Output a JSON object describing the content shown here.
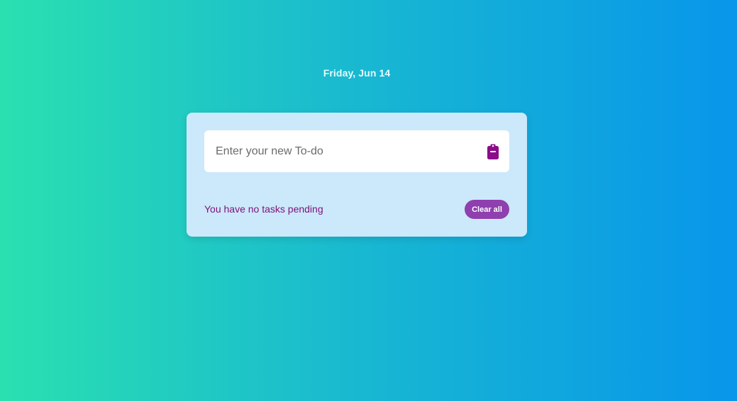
{
  "header": {
    "date": "Friday, Jun 14"
  },
  "todo": {
    "input_placeholder": "Enter your new To-do",
    "input_value": "",
    "add_icon": "clipboard-icon",
    "status_text": "You have no tasks pending",
    "clear_label": "Clear all"
  },
  "colors": {
    "gradient_start": "#2ae0b0",
    "gradient_end": "#0896ea",
    "card_bg": "#cce8fb",
    "accent_purple": "#8f3fae",
    "status_text": "#7a1477"
  }
}
